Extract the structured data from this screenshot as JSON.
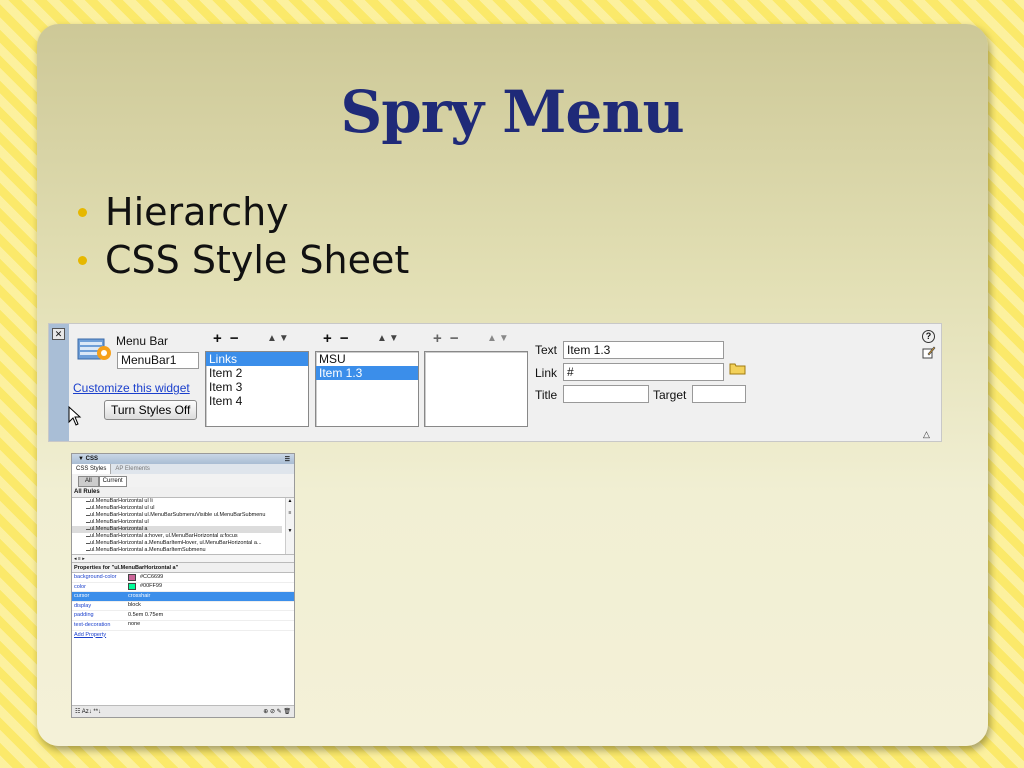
{
  "slide": {
    "title": "Spry Menu",
    "bullets": [
      "Hierarchy",
      "CSS Style Sheet"
    ]
  },
  "property_inspector": {
    "widget_label": "Menu Bar",
    "widget_name": "MenuBar1",
    "customize_link": "Customize this widget",
    "turn_styles_off_button": "Turn Styles Off",
    "level1": {
      "add_remove": "+ −",
      "arrows": "▲▼",
      "items": [
        "Links",
        "Item 2",
        "Item 3",
        "Item 4"
      ],
      "selected": 0
    },
    "level2": {
      "add_remove": "+ −",
      "arrows": "▲▼",
      "items": [
        "MSU",
        "Item 1.3"
      ],
      "selected": 1
    },
    "level3": {
      "add_remove": "+ −",
      "arrows": "▲▼",
      "items": []
    },
    "text_label": "Text",
    "text_value": "Item 1.3",
    "link_label": "Link",
    "link_value": "#",
    "title_label": "Title",
    "title_value": "",
    "target_label": "Target",
    "target_value": "",
    "help_symbol": "?",
    "collapse_symbol": "△"
  },
  "css_panel": {
    "header": "▼ CSS",
    "tab_css_styles": "CSS Styles",
    "tab_ap_elements": "AP Elements",
    "btn_all": "All",
    "btn_current": "Current",
    "all_rules_label": "All Rules",
    "rules": [
      "ul.MenuBarHorizontal ul li",
      "ul.MenuBarHorizontal ul ul",
      "ul.MenuBarHorizontal ul.MenuBarSubmenuVisible ul.MenuBarSubmenu",
      "ul.MenuBarHorizontal ul",
      "ul.MenuBarHorizontal a",
      "ul.MenuBarHorizontal a:hover, ul.MenuBarHorizontal a:focus",
      "ul.MenuBarHorizontal a.MenuBarItemHover, ul.MenuBarHorizontal a...",
      "ul.MenuBarHorizontal a.MenuBarItemSubmenu"
    ],
    "selected_rule": 4,
    "properties_title": "Properties for \"ul.MenuBarHorizontal a\"",
    "properties": [
      {
        "name": "background-color",
        "value": "#CC6699",
        "swatch": "#CC6699"
      },
      {
        "name": "color",
        "value": "#00FF99",
        "swatch": "#00FF99"
      },
      {
        "name": "cursor",
        "value": "crosshair"
      },
      {
        "name": "display",
        "value": "block"
      },
      {
        "name": "padding",
        "value": "0.5em 0.75em"
      },
      {
        "name": "text-decoration",
        "value": "none"
      }
    ],
    "selected_property": 2,
    "add_property": "Add Property",
    "footer_left": "☷ Az↓ **↓",
    "footer_right": "⊕ ⊘ ✎ 🗑"
  },
  "colors": {
    "title": "#1f2a78",
    "bullet": "#e6b800",
    "selection": "#3b8eea",
    "link": "#1a3fcc"
  }
}
